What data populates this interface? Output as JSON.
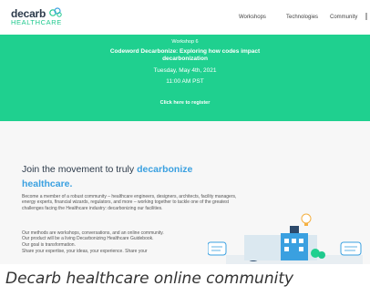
{
  "header": {
    "logo_top": "decarb",
    "logo_bottom": "HEALTHCARE",
    "nav": [
      "Workshops",
      "Technologies",
      "Community"
    ]
  },
  "hero": {
    "label": "Workshop 6",
    "title": "Codeword Decarbonize: Exploring how codes impact decarbonization",
    "date": "Tuesday, May 4th, 2021",
    "time": "11:00 AM PST",
    "register": "Click here to register"
  },
  "main": {
    "headline_plain": "Join the movement to truly ",
    "headline_accent": "decarbonize healthcare.",
    "paragraph1": "Become a member of a robust community – healthcare engineers, designers, architects, facility managers, energy experts, financial wizards, regulators, and more – working together to tackle one of the greatest challenges facing the Healthcare industry: decarbonizing our facilities.",
    "paragraph2_lines": [
      "Our methods are workshops, conversations, and an online community.",
      "Our product will be a living Decarbonizing Healthcare Guidebook.",
      "Our goal is transformation."
    ],
    "paragraph3": "Share your expertise, your ideas, your experience. Share your"
  },
  "caption": "Decarb healthcare online community",
  "colors": {
    "brand_green": "#1fd08f",
    "accent_blue": "#3aa0e0",
    "navy": "#2d3b4b"
  }
}
